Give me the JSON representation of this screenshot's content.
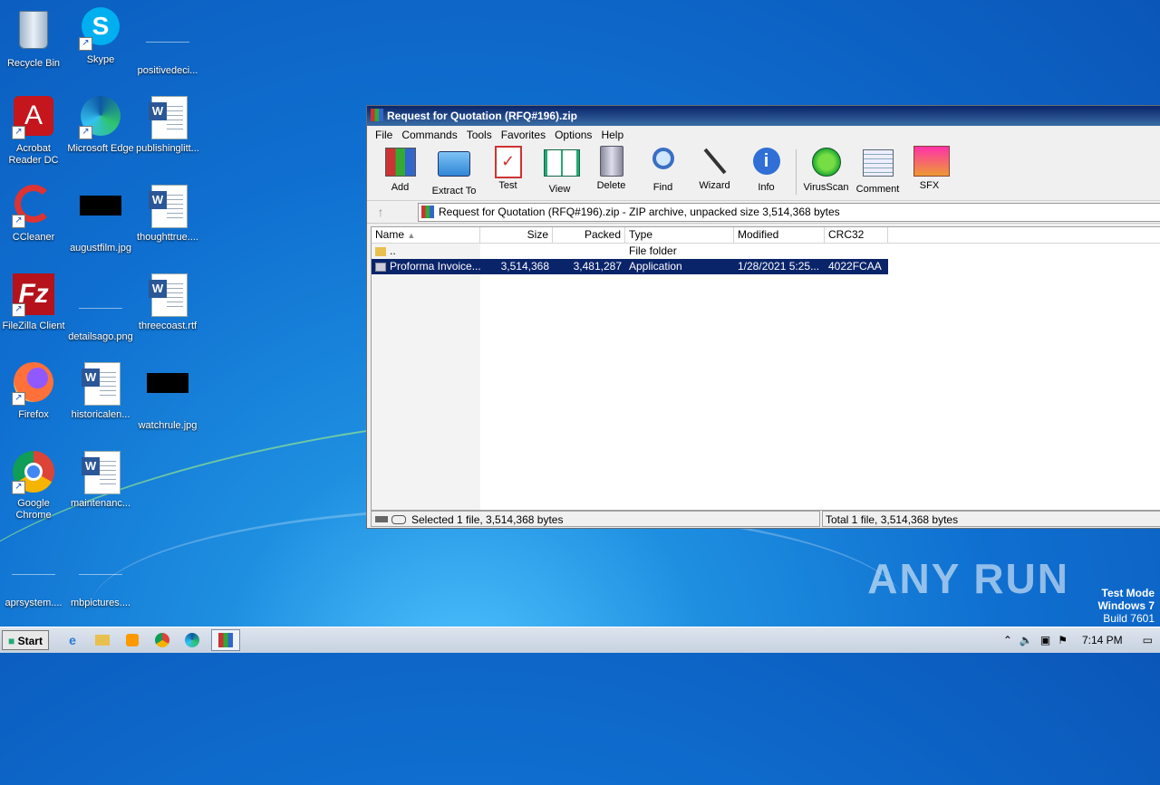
{
  "desktop": {
    "icons": [
      {
        "label": "Recycle Bin"
      },
      {
        "label": "Skype"
      },
      {
        "label": "positivedeci..."
      },
      {
        "label": "Acrobat Reader DC"
      },
      {
        "label": "Microsoft Edge"
      },
      {
        "label": "publishinglitt..."
      },
      {
        "label": "CCleaner"
      },
      {
        "label": "augustfilm.jpg"
      },
      {
        "label": "thoughttrue...."
      },
      {
        "label": "FileZilla Client"
      },
      {
        "label": "detailsago.png"
      },
      {
        "label": "threecoast.rtf"
      },
      {
        "label": "Firefox"
      },
      {
        "label": "historicalen..."
      },
      {
        "label": "watchrule.jpg"
      },
      {
        "label": "Google Chrome"
      },
      {
        "label": "maintenanc..."
      },
      {
        "label": "aprsystem...."
      },
      {
        "label": "mbpictures...."
      }
    ]
  },
  "window": {
    "title": "Request for Quotation (RFQ#196).zip",
    "menu": [
      "File",
      "Commands",
      "Tools",
      "Favorites",
      "Options",
      "Help"
    ],
    "toolbar": [
      "Add",
      "Extract To",
      "Test",
      "View",
      "Delete",
      "Find",
      "Wizard",
      "Info",
      "VirusScan",
      "Comment",
      "SFX"
    ],
    "address": "Request for Quotation (RFQ#196).zip - ZIP archive, unpacked size 3,514,368 bytes",
    "columns": [
      "Name",
      "Size",
      "Packed",
      "Type",
      "Modified",
      "CRC32"
    ],
    "rows": [
      {
        "name": "..",
        "size": "",
        "packed": "",
        "type": "File folder",
        "modified": "",
        "crc": ""
      },
      {
        "name": "Proforma Invoice....",
        "size": "3,514,368",
        "packed": "3,481,287",
        "type": "Application",
        "modified": "1/28/2021 5:25...",
        "crc": "4022FCAA"
      }
    ],
    "status_left": "Selected 1 file, 3,514,368 bytes",
    "status_right": "Total 1 file, 3,514,368 bytes"
  },
  "taskbar": {
    "start": "Start",
    "clock": "7:14 PM"
  },
  "watermark": "ANY RUN",
  "testmode": {
    "line1": "Test Mode",
    "line2": "Windows 7",
    "line3": "Build 7601"
  }
}
